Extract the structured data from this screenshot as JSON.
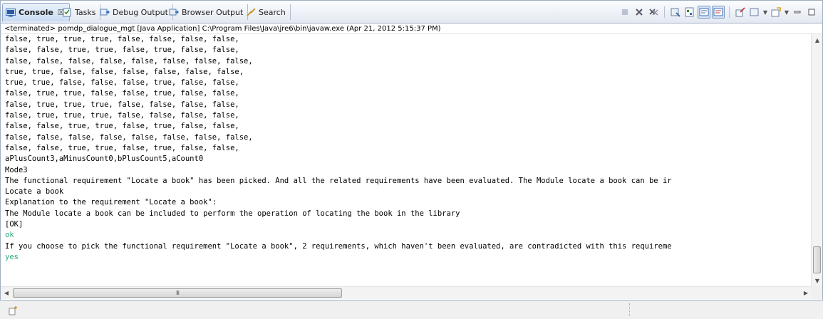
{
  "tabs": [
    {
      "label": "Console",
      "icon": "console-icon",
      "active": true,
      "close": "☒"
    },
    {
      "label": "Tasks",
      "icon": "tasks-icon"
    },
    {
      "label": "Debug Output",
      "icon": "debug-output-icon"
    },
    {
      "label": "Browser Output",
      "icon": "browser-output-icon"
    },
    {
      "label": "Search",
      "icon": "search-icon"
    }
  ],
  "toolbar_icons": [
    "terminate-icon",
    "remove-launch-icon",
    "remove-all-terminated-icon",
    "clear-console-icon",
    "scroll-lock-icon",
    "show-on-stdout-icon",
    "show-on-stderr-icon",
    "pin-console-icon",
    "display-selected-console-icon",
    "open-console-icon",
    "minimize-icon",
    "maximize-icon"
  ],
  "status_line": "<terminated> pomdp_dialogue_mgt [Java Application] C:\\Program Files\\Java\\jre6\\bin\\javaw.exe (Apr 21, 2012 5:15:37 PM)",
  "console_lines": [
    {
      "text": "false, true, true, true, false, false, false, false,"
    },
    {
      "text": "false, false, true, true, false, true, false, false,"
    },
    {
      "text": "false, false, false, false, false, false, false, false,"
    },
    {
      "text": "true, true, false, false, false, false, false, false,"
    },
    {
      "text": "true, true, false, false, false, true, false, false,"
    },
    {
      "text": "false, true, true, false, false, true, false, false,"
    },
    {
      "text": "false, true, true, true, false, false, false, false,"
    },
    {
      "text": "false, true, true, true, false, false, false, false,"
    },
    {
      "text": "false, false, true, true, false, true, false, false,"
    },
    {
      "text": "false, false, false, false, false, false, false, false,"
    },
    {
      "text": "false, false, true, true, false, true, false, false,"
    },
    {
      "text": "aPlusCount3,aMinusCount0,bPlusCount5,aCount0"
    },
    {
      "text": "Mode3"
    },
    {
      "text": "The functional requirement \"Locate a book\" has been picked. And all the related requirements have been evaluated. The Module locate a book can be ir"
    },
    {
      "text": "Locate a book"
    },
    {
      "text": "Explanation to the requirement \"Locate a book\":"
    },
    {
      "text": "The Module locate a book can be included to perform the operation of locating the book in the library"
    },
    {
      "text": "[OK]"
    },
    {
      "text": "ok",
      "input": true
    },
    {
      "text": "If you choose to pick the functional requirement \"Locate a book\", 2 requirements, which haven't been evaluated, are contradicted with this requireme"
    },
    {
      "text": "yes",
      "input": true
    }
  ],
  "hscroll_grip": "III",
  "colors": {
    "stdin": "#2aa87a",
    "stdout": "#000000"
  }
}
